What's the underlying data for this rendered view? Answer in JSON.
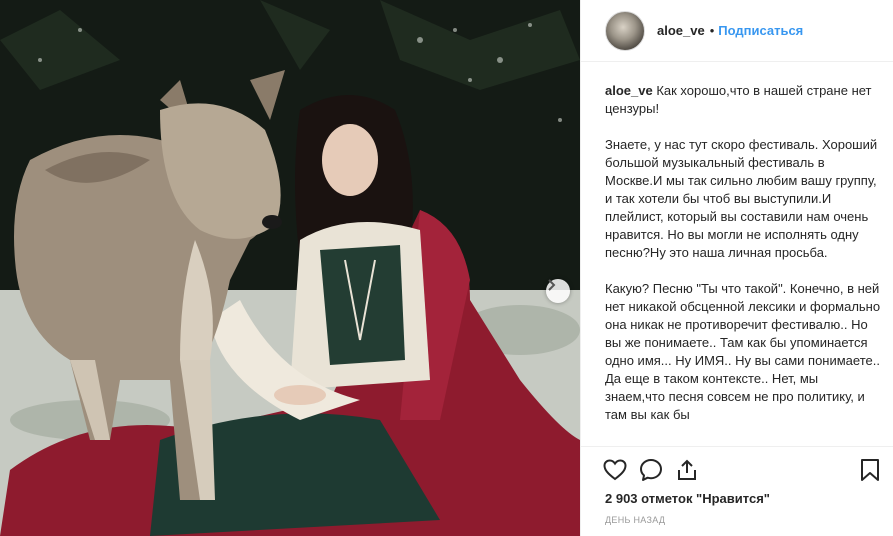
{
  "post": {
    "image_alt": "",
    "username": "aloe_ve",
    "separator": "•",
    "follow_label": "Подписаться",
    "caption": {
      "username": "aloe_ve",
      "paragraphs": [
        "Как хорошо,что в нашей стране нет цензуры!",
        "Знаете, у нас тут скоро фестиваль. Хороший большой музыкальный фестиваль в Москве.И мы так сильно любим вашу группу, и так хотели бы чтоб вы выступили.И плейлист, который вы составили нам очень нравится. Но вы могли не исполнять одну песню?Ну это наша личная просьба.",
        "Какую? Песню \"Ты что такой\". Конечно, в ней нет никакой обсценной  лексики и формально она никак не противоречит фестивалю.. Но вы же понимаете.. Там как бы упоминается одно имя... Ну ИМЯ.. Ну вы сами понимаете.. Да еще в таком контексте.. Нет, мы знаем,что песня совсем не про политику, и там вы как бы"
      ]
    },
    "likes_text": "2 903 отметок \"Нравится\"",
    "timestamp": "ДЕНЬ НАЗАД",
    "icons": {
      "like": "heart-icon",
      "comment": "comment-icon",
      "share": "share-icon",
      "save": "bookmark-icon",
      "carousel": "chevron-right-icon"
    },
    "colors": {
      "accent": "#3897f0",
      "text": "#262626",
      "muted": "#999999",
      "cape": "#8e1b2e"
    }
  }
}
